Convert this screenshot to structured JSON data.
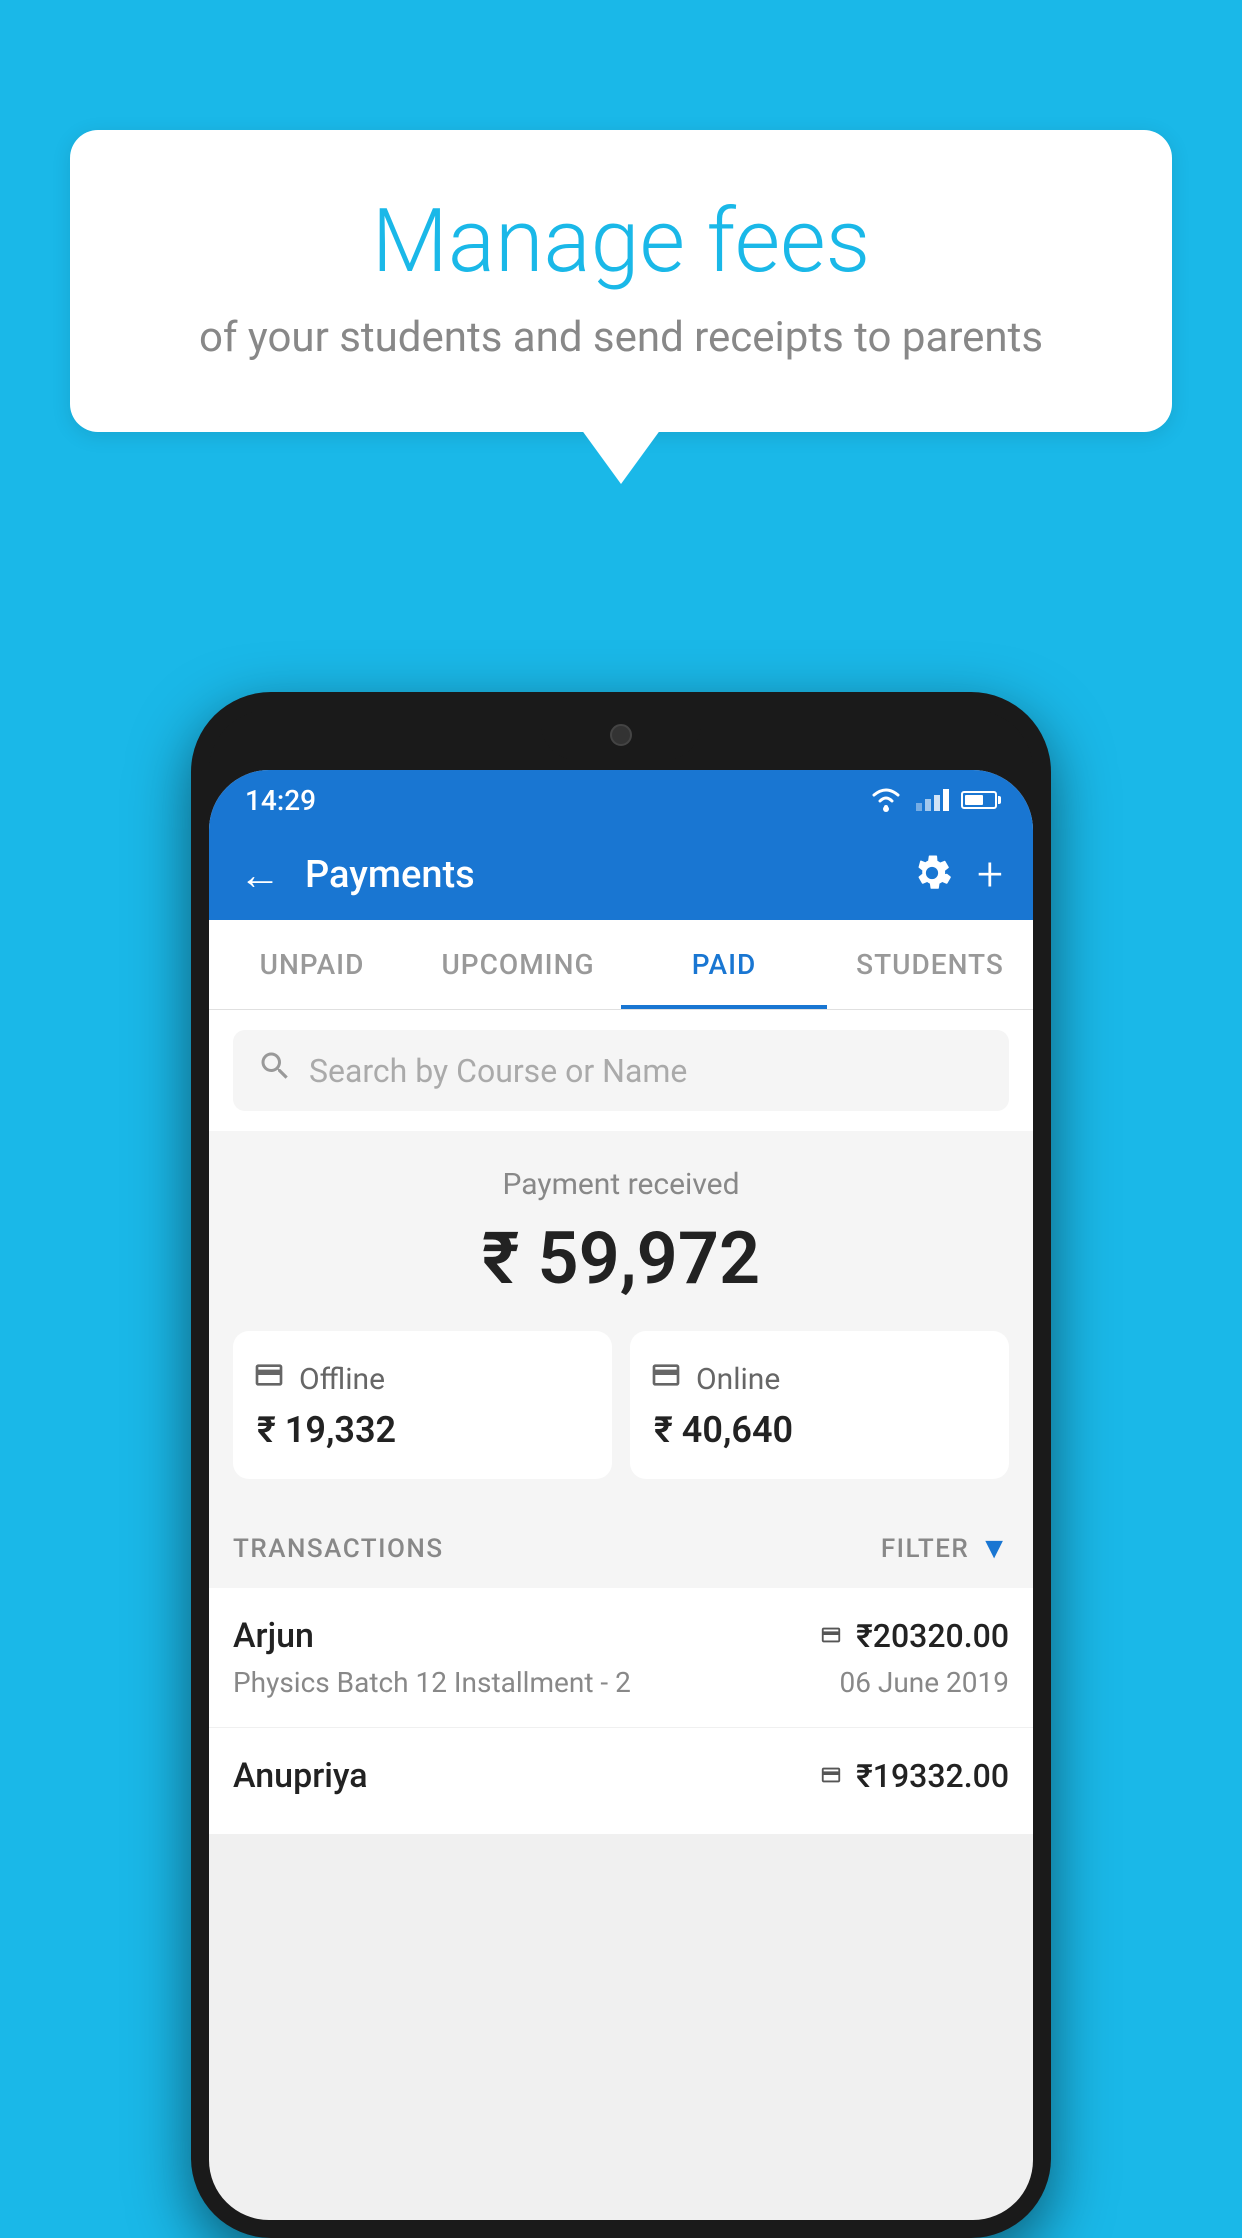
{
  "background_color": "#1ab8e8",
  "speech_bubble": {
    "title": "Manage fees",
    "subtitle": "of your students and send receipts to parents"
  },
  "status_bar": {
    "time": "14:29"
  },
  "header": {
    "title": "Payments",
    "back_label": "←",
    "plus_label": "+"
  },
  "tabs": [
    {
      "id": "unpaid",
      "label": "UNPAID",
      "active": false
    },
    {
      "id": "upcoming",
      "label": "UPCOMING",
      "active": false
    },
    {
      "id": "paid",
      "label": "PAID",
      "active": true
    },
    {
      "id": "students",
      "label": "STUDENTS",
      "active": false
    }
  ],
  "search": {
    "placeholder": "Search by Course or Name"
  },
  "payment_summary": {
    "label": "Payment received",
    "amount": "₹ 59,972",
    "offline": {
      "label": "Offline",
      "amount": "₹ 19,332"
    },
    "online": {
      "label": "Online",
      "amount": "₹ 40,640"
    }
  },
  "transactions_section": {
    "label": "TRANSACTIONS",
    "filter_label": "FILTER"
  },
  "transactions": [
    {
      "name": "Arjun",
      "detail": "Physics Batch 12 Installment - 2",
      "amount": "₹20320.00",
      "date": "06 June 2019",
      "payment_type": "card"
    },
    {
      "name": "Anupriya",
      "detail": "",
      "amount": "₹19332.00",
      "date": "",
      "payment_type": "cash"
    }
  ]
}
